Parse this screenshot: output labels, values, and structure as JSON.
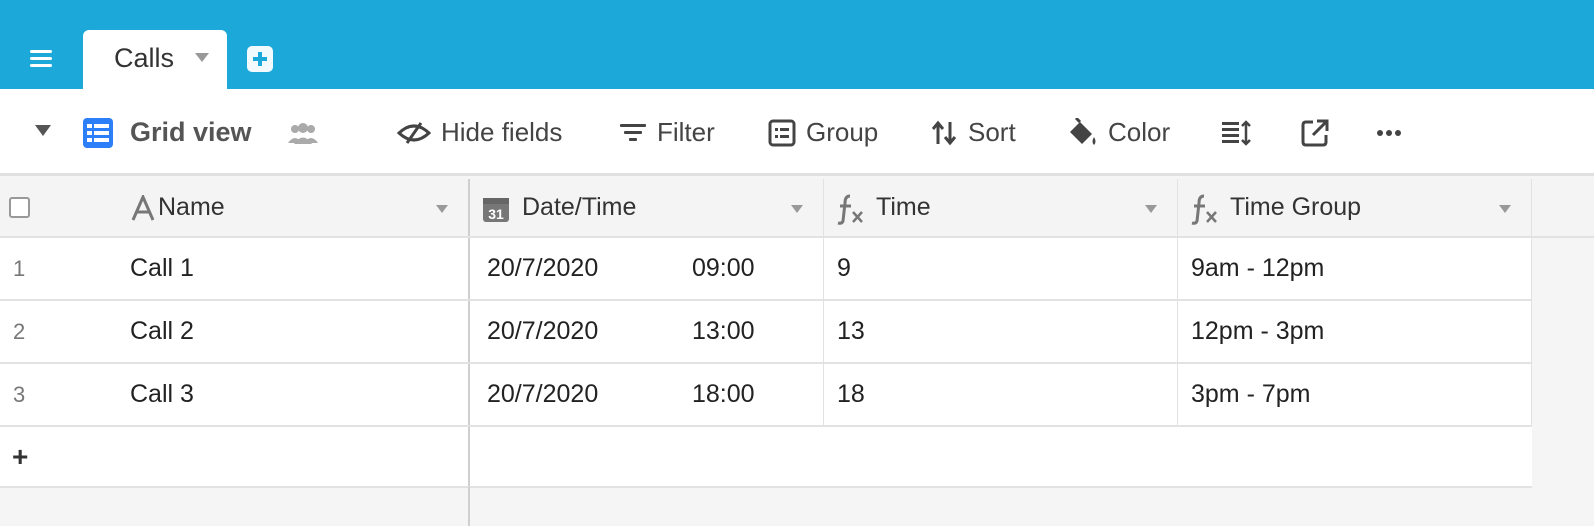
{
  "tabs": [
    {
      "label": "Calls"
    }
  ],
  "toolbar": {
    "view_name": "Grid view",
    "hide_fields": "Hide fields",
    "filter": "Filter",
    "group": "Group",
    "sort": "Sort",
    "color": "Color"
  },
  "grid": {
    "columns": [
      {
        "name": "Name",
        "icon": "text-field-icon"
      },
      {
        "name": "Date/Time",
        "icon": "calendar-icon",
        "icon_text": "31"
      },
      {
        "name": "Time",
        "icon": "formula-icon"
      },
      {
        "name": "Time Group",
        "icon": "formula-icon"
      }
    ],
    "rows": [
      {
        "num": "1",
        "name": "Call 1",
        "date": "20/7/2020",
        "time": "09:00",
        "time_value": "9",
        "time_group": "9am - 12pm"
      },
      {
        "num": "2",
        "name": "Call 2",
        "date": "20/7/2020",
        "time": "13:00",
        "time_value": "13",
        "time_group": "12pm - 3pm"
      },
      {
        "num": "3",
        "name": "Call 3",
        "date": "20/7/2020",
        "time": "18:00",
        "time_value": "18",
        "time_group": "3pm - 7pm"
      }
    ],
    "add_row_symbol": "+"
  },
  "colors": {
    "brand": "#1ca8d9",
    "grid_view_icon": "#2d7ff9"
  }
}
